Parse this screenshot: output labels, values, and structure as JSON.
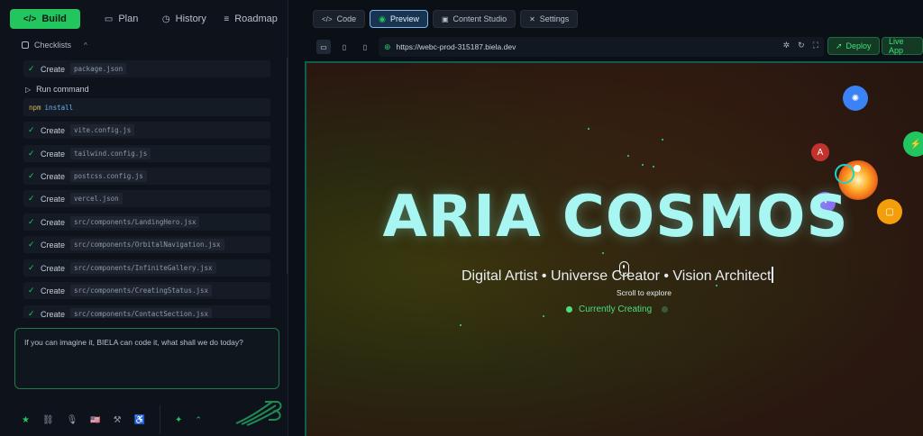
{
  "nav": {
    "build": "Build",
    "plan": "Plan",
    "history": "History",
    "roadmap": "Roadmap"
  },
  "checklists": {
    "label": "Checklists"
  },
  "steps": [
    {
      "action": "Create",
      "file": "package.json"
    },
    {
      "action": "Create",
      "file": "vite.config.js"
    },
    {
      "action": "Create",
      "file": "tailwind.config.js"
    },
    {
      "action": "Create",
      "file": "postcss.config.js"
    },
    {
      "action": "Create",
      "file": "vercel.json"
    },
    {
      "action": "Create",
      "file": "src/components/LandingHero.jsx"
    },
    {
      "action": "Create",
      "file": "src/components/OrbitalNavigation.jsx"
    },
    {
      "action": "Create",
      "file": "src/components/InfiniteGallery.jsx"
    },
    {
      "action": "Create",
      "file": "src/components/CreatingStatus.jsx"
    },
    {
      "action": "Create",
      "file": "src/components/ContactSection.jsx"
    }
  ],
  "run": {
    "label": "Run command",
    "cmd_key": "npm",
    "cmd_val": "install"
  },
  "prompt": {
    "placeholder": "If you can imagine it, BIELA can code it, what shall we do today?"
  },
  "tabs": {
    "code": "Code",
    "preview": "Preview",
    "content": "Content Studio",
    "settings": "Settings"
  },
  "url": "https://webc-prod-315187.biela.dev",
  "actions": {
    "deploy": "Deploy",
    "live": "Live App"
  },
  "site": {
    "title": "ARIA COSMOS",
    "subtitle": "Digital Artist • Universe Creator • Vision Architect",
    "scroll": "Scroll to explore",
    "status": "Currently Creating"
  },
  "icons": {
    "build": "code-icon",
    "plan": "chat-icon",
    "history": "clock-icon",
    "roadmap": "list-icon",
    "check": "check-icon",
    "run": "play-icon",
    "star": "star-icon",
    "link": "link-icon",
    "mic": "mic-icon",
    "flag": "us-flag-icon",
    "wand": "magic-wand-icon",
    "accessibility": "accessibility-icon",
    "sparkle": "sparkles-icon",
    "chevron": "chevron-up-icon"
  },
  "colors": {
    "accent": "#22c55e",
    "hero": "#a7f6f2",
    "preview_border": "#0f5c50"
  }
}
